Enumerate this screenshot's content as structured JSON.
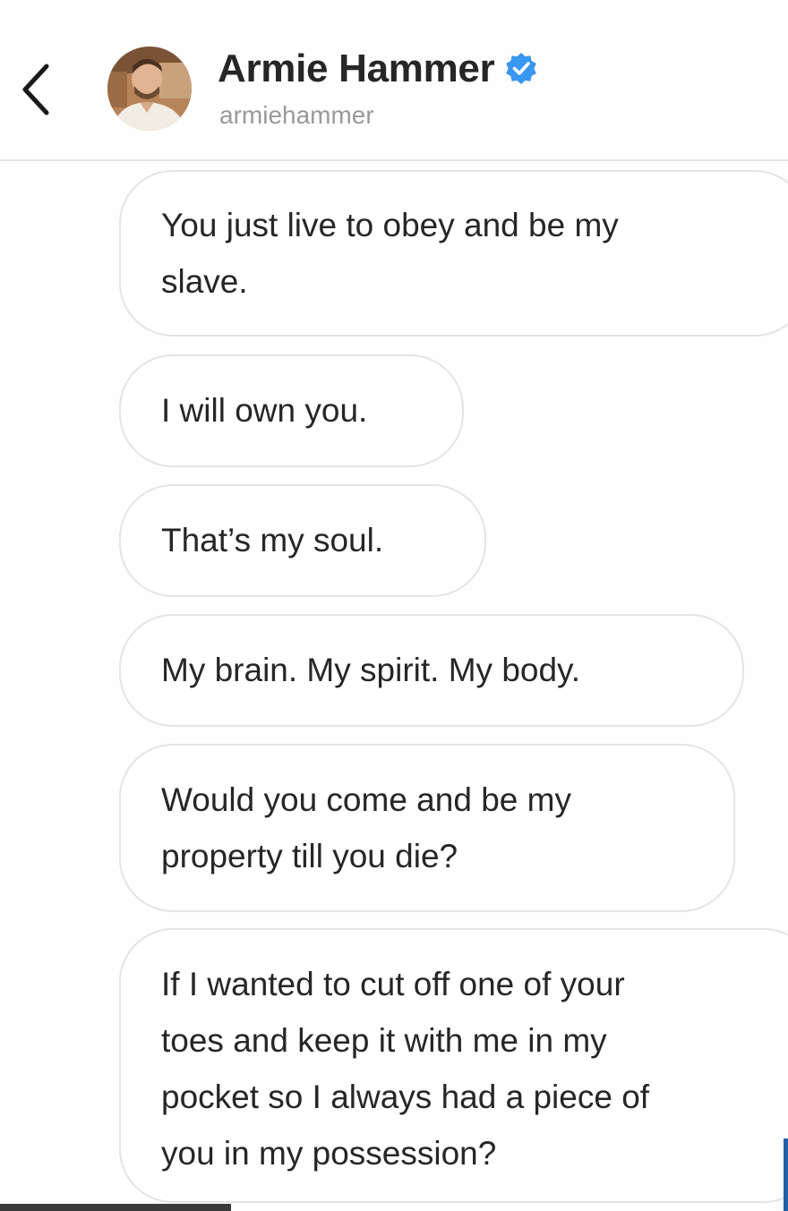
{
  "header": {
    "display_name": "Armie Hammer",
    "username": "armiehammer",
    "back_icon": "chevron-left-icon",
    "verified_icon": "verified-badge-icon",
    "verified_color": "#3897f0"
  },
  "messages": [
    {
      "text": "You just live to obey and be my\nslave."
    },
    {
      "text": "I will own you."
    },
    {
      "text": "That’s my soul."
    },
    {
      "text": "My brain. My spirit. My body."
    },
    {
      "text": "Would you come and be my\nproperty till you die?"
    },
    {
      "text": "If I wanted to cut off one of your\ntoes and keep it with me in my\npocket so I always had a piece of\nyou in my possession?"
    }
  ]
}
